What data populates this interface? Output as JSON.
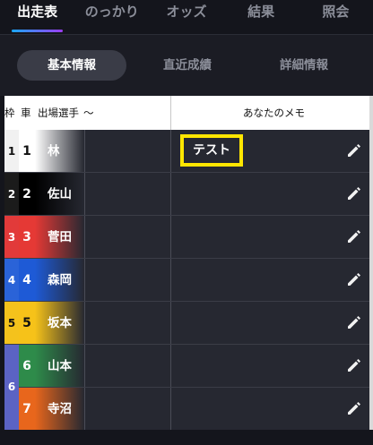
{
  "top_tabs": [
    {
      "label": "出走表",
      "active": true
    },
    {
      "label": "のっかり",
      "active": false
    },
    {
      "label": "オッズ",
      "active": false
    },
    {
      "label": "結果",
      "active": false
    },
    {
      "label": "照会",
      "active": false
    }
  ],
  "sub_tabs": [
    {
      "label": "基本情報",
      "active": true
    },
    {
      "label": "直近成績",
      "active": false
    },
    {
      "label": "詳細情報",
      "active": false
    }
  ],
  "table": {
    "headers": {
      "waku": "枠",
      "car": "車",
      "player": "出場選手",
      "extra": "〜",
      "memo": "あなたのメモ"
    },
    "rows": [
      {
        "waku": "1",
        "car": "1",
        "name": "林",
        "memo": "テスト",
        "waku_color": "#f1f1f1",
        "car_color": "#ffffff",
        "waku_text": "#111111",
        "car_text": "#111111"
      },
      {
        "waku": "2",
        "car": "2",
        "name": "佐山",
        "memo": "",
        "waku_color": "#1b1b1b",
        "car_color": "#000000",
        "waku_text": "#ffffff",
        "car_text": "#ffffff"
      },
      {
        "waku": "3",
        "car": "3",
        "name": "菅田",
        "memo": "",
        "waku_color": "#e23a3a",
        "car_color": "#e53935",
        "waku_text": "#ffffff",
        "car_text": "#ffffff"
      },
      {
        "waku": "4",
        "car": "4",
        "name": "森岡",
        "memo": "",
        "waku_color": "#2a63d8",
        "car_color": "#1e5ad6",
        "waku_text": "#ffffff",
        "car_text": "#ffffff"
      },
      {
        "waku": "5",
        "car": "5",
        "name": "坂本",
        "memo": "",
        "waku_color": "#f4c21c",
        "car_color": "#f6c219",
        "waku_text": "#111111",
        "car_text": "#111111"
      },
      {
        "waku": "6",
        "car": "6",
        "name": "山本",
        "memo": "",
        "waku_color": "#5b63c4",
        "car_color": "#2e8b4a",
        "waku_text": "#ffffff",
        "car_text": "#ffffff"
      },
      {
        "waku": "6",
        "car": "7",
        "name": "寺沼",
        "memo": "",
        "waku_color": "#5b63c4",
        "car_color": "#e8661c",
        "waku_text": "#ffffff",
        "car_text": "#ffffff"
      }
    ]
  },
  "icons": {
    "edit": "pencil-icon"
  },
  "colors": {
    "accent_gradient_start": "#1aa7ff",
    "accent_gradient_end": "#9b3df0",
    "memo_highlight": "#ffe600"
  }
}
